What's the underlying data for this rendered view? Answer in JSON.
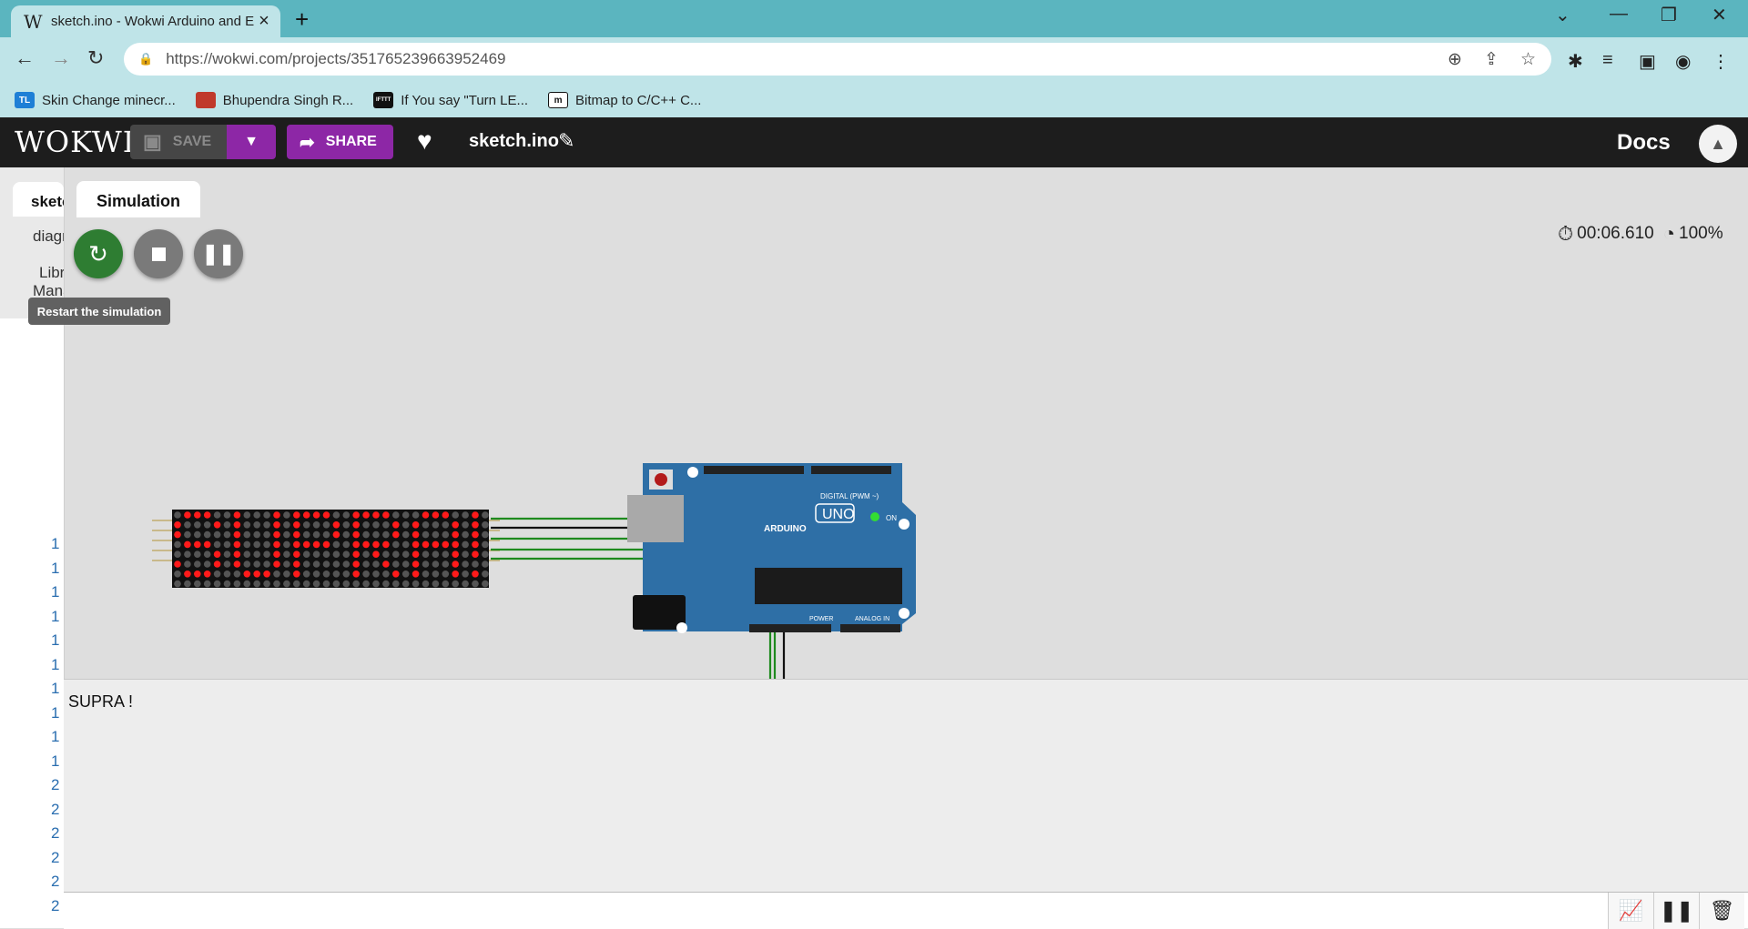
{
  "browser": {
    "tab_title": "sketch.ino - Wokwi Arduino and E",
    "tab_favicon": "W",
    "url": "https://wokwi.com/projects/351765239663952469",
    "bookmarks": [
      {
        "label": "Skin Change minecr...",
        "icon": "TL",
        "color": "#1e7fd6"
      },
      {
        "label": "Bhupendra Singh R...",
        "icon": "",
        "color": "#c0392b"
      },
      {
        "label": "If You say \"Turn LE...",
        "icon": "IFTTT",
        "color": "#111111"
      },
      {
        "label": "Bitmap to C/C++ C...",
        "icon": "m",
        "color": "#ffffff"
      }
    ]
  },
  "header": {
    "logo": "WOKWI",
    "save_label": "SAVE",
    "share_label": "SHARE",
    "project_name": "sketch.ino",
    "docs_label": "Docs"
  },
  "editor": {
    "tab_label": "sketch.ino",
    "diagram_label": "diagram.json",
    "library_label": "Library",
    "manager_label": "Manager",
    "line_numbers": [
      "1",
      "1",
      "1",
      "1",
      "1",
      "1",
      "1",
      "1",
      "1",
      "1",
      "2",
      "2",
      "2",
      "2",
      "2",
      "2"
    ]
  },
  "simulation": {
    "tab_label": "Simulation",
    "tooltip": "Restart the simulation",
    "time": "00:06.610",
    "speed": "100%",
    "board_label": "UNO",
    "board_brand": "ARDUINO",
    "digital_label": "DIGITAL (PWM ~)",
    "power_label": "POWER",
    "analog_label": "ANALOG IN",
    "on_label": "ON",
    "matrix_text": "SUPRA!"
  },
  "serial": {
    "output": "SUPRA !"
  },
  "colors": {
    "accent": "#8d27a6",
    "restart": "#2e7d32",
    "board": "#2e6fa6",
    "led_on": "#ff1a1a",
    "led_off": "#555555",
    "wire_green": "#1f8a1f"
  }
}
